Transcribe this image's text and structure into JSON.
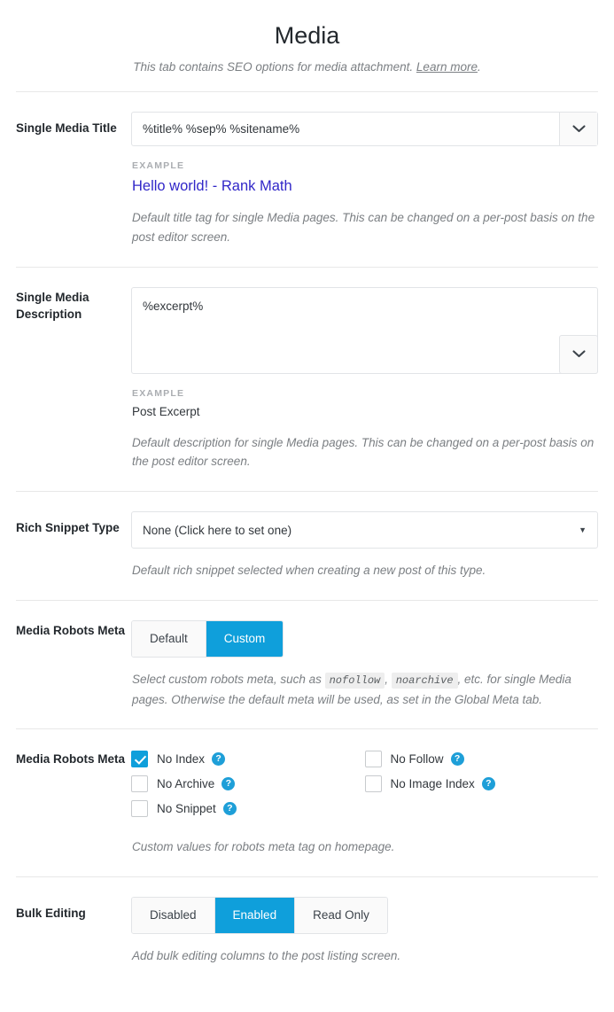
{
  "header": {
    "title": "Media",
    "description_before": "This tab contains SEO options for media attachment. ",
    "link_label": "Learn more",
    "description_after": "."
  },
  "single_media_title": {
    "label": "Single Media Title",
    "value": "%title% %sep% %sitename%",
    "placeholder": "%title% %sep% %sitename%",
    "chevron_icon": "chevron-down-icon",
    "example_label": "EXAMPLE",
    "example_value": "Hello world! - Rank Math",
    "help": "Default title tag for single Media pages. This can be changed on a per-post basis on the post editor screen."
  },
  "single_media_description": {
    "label": "Single Media Description",
    "value": "%excerpt%",
    "placeholder": "%excerpt%",
    "chevron_icon": "chevron-down-icon",
    "example_label": "EXAMPLE",
    "example_value": "Post Excerpt",
    "help": "Default description for single Media pages. This can be changed on a per-post basis on the post editor screen."
  },
  "rich_snippet_type": {
    "label": "Rich Snippet Type",
    "selected": "None (Click here to set one)",
    "arrow_icon": "chevron-down-icon",
    "help": "Default rich snippet selected when creating a new post of this type."
  },
  "media_robots_meta_toggle": {
    "label": "Media Robots Meta",
    "options": [
      {
        "label": "Default",
        "active": false
      },
      {
        "label": "Custom",
        "active": true
      }
    ],
    "help_part1": "Select custom robots meta, such as ",
    "help_code1": "nofollow",
    "help_part2": ", ",
    "help_code2": "noarchive",
    "help_part3": ", etc. for single Media pages. Otherwise the default meta will be used, as set in the Global Meta tab."
  },
  "media_robots_meta_checkboxes": {
    "label": "Media Robots Meta",
    "left_column": [
      {
        "label": "No Index",
        "checked": true,
        "help_icon": "question-mark-icon"
      },
      {
        "label": "No Archive",
        "checked": false,
        "help_icon": "question-mark-icon"
      },
      {
        "label": "No Snippet",
        "checked": false,
        "help_icon": "question-mark-icon"
      }
    ],
    "right_column": [
      {
        "label": "No Follow",
        "checked": false,
        "help_icon": "question-mark-icon"
      },
      {
        "label": "No Image Index",
        "checked": false,
        "help_icon": "question-mark-icon"
      }
    ],
    "help_icon_glyph": "?",
    "help": "Custom values for robots meta tag on homepage."
  },
  "bulk_editing": {
    "label": "Bulk Editing",
    "options": [
      {
        "label": "Disabled",
        "active": false
      },
      {
        "label": "Enabled",
        "active": true
      },
      {
        "label": "Read Only",
        "active": false
      }
    ],
    "help": "Add bulk editing columns to the post listing screen."
  },
  "colors": {
    "accent_blue": "#0f9fdb",
    "help_icon_blue": "#1e9fd8",
    "example_link": "#3127c8",
    "help_text": "#7b7f83",
    "divider": "#e8e8e8"
  }
}
